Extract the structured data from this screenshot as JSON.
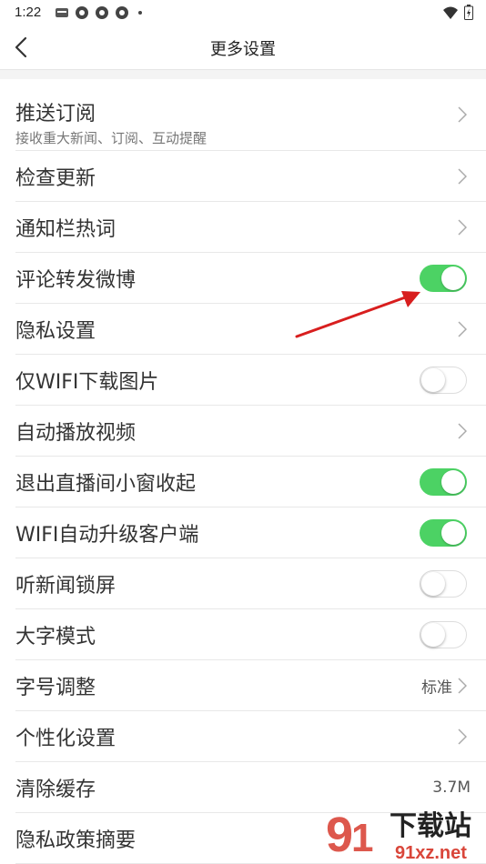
{
  "status_bar": {
    "time": "1:22"
  },
  "nav": {
    "title": "更多设置"
  },
  "settings": [
    {
      "label": "推送订阅",
      "sub": "接收重大新闻、订阅、互动提醒",
      "control": "chevron"
    },
    {
      "label": "检查更新",
      "control": "chevron"
    },
    {
      "label": "通知栏热词",
      "control": "chevron"
    },
    {
      "label": "评论转发微博",
      "control": "toggle",
      "on": true
    },
    {
      "label": "隐私设置",
      "control": "chevron"
    },
    {
      "label": "仅WIFI下载图片",
      "control": "toggle",
      "on": false
    },
    {
      "label": "自动播放视频",
      "control": "chevron"
    },
    {
      "label": "退出直播间小窗收起",
      "control": "toggle",
      "on": true
    },
    {
      "label": "WIFI自动升级客户端",
      "control": "toggle",
      "on": true
    },
    {
      "label": "听新闻锁屏",
      "control": "toggle",
      "on": false
    },
    {
      "label": "大字模式",
      "control": "toggle",
      "on": false
    },
    {
      "label": "字号调整",
      "value": "标准",
      "control": "chevron"
    },
    {
      "label": "个性化设置",
      "control": "chevron"
    },
    {
      "label": "清除缓存",
      "value": "3.7M",
      "control": "value"
    },
    {
      "label": "隐私政策摘要",
      "control": "none"
    }
  ],
  "watermark": {
    "brand": "下载站",
    "url": "91xz.net"
  },
  "colors": {
    "toggle_on": "#4cd264",
    "annotation_arrow": "#d81e1e"
  }
}
